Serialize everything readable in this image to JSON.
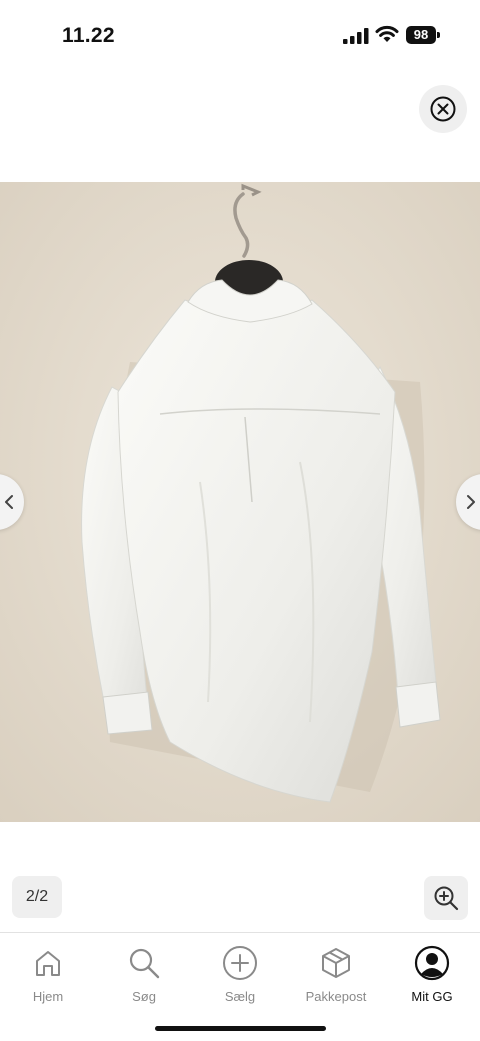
{
  "status_bar": {
    "time": "11.22",
    "battery": "98"
  },
  "icons": {
    "close": "close-circle-icon",
    "prev": "chevron-left-icon",
    "next": "chevron-right-icon",
    "zoom": "zoom-in-icon"
  },
  "gallery": {
    "counter": "2/2",
    "image_subject": "white shirt on hanger"
  },
  "tabs": [
    {
      "label": "Hjem",
      "icon": "home-icon",
      "active": false
    },
    {
      "label": "Søg",
      "icon": "search-icon",
      "active": false
    },
    {
      "label": "Sælg",
      "icon": "plus-circle-icon",
      "active": false
    },
    {
      "label": "Pakkepost",
      "icon": "package-icon",
      "active": false
    },
    {
      "label": "Mit GG",
      "icon": "profile-icon",
      "active": true
    }
  ],
  "colors": {
    "tab_inactive": "#8a8a8a",
    "tab_active": "#111111",
    "button_bg": "#efefef"
  }
}
